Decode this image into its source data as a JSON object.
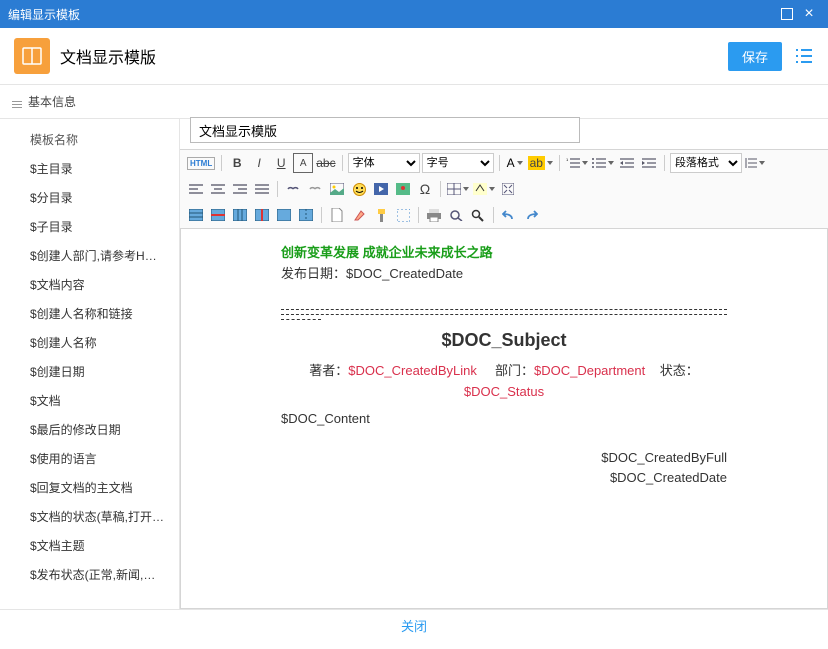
{
  "window": {
    "title": "编辑显示模板"
  },
  "header": {
    "title": "文档显示模版",
    "save": "保存"
  },
  "section": {
    "basic": "基本信息"
  },
  "sidebar": {
    "label": "模板名称",
    "items": [
      "$主目录",
      "$分目录",
      "$子目录",
      "$创建人部门,请参考HRM(...",
      "$文档内容",
      "$创建人名称和链接",
      "$创建人名称",
      "$创建日期",
      "$文档",
      "$最后的修改日期",
      "$使用的语言",
      "$回复文档的主文档",
      "$文档的状态(草稿,打开,正...",
      "$文档主题",
      "$发布状态(正常,新闻,标题..."
    ]
  },
  "form": {
    "template_name": "文档显示模版"
  },
  "toolbar": {
    "font": "字体",
    "size": "字号",
    "para": "段落格式"
  },
  "preview": {
    "green": "创新变革发展 成就企业未来成长之路",
    "pub_label": "发布日期：",
    "pub_var": "$DOC_CreatedDate",
    "subject": "$DOC_Subject",
    "author_label": "著者：",
    "author_var": "$DOC_CreatedByLink",
    "dept_label": "部门：",
    "dept_var": "$DOC_Department",
    "status_label": "状态：",
    "status_var": "$DOC_Status",
    "content_var": "$DOC_Content",
    "footer1": "$DOC_CreatedByFull",
    "footer2": "$DOC_CreatedDate"
  },
  "footer": {
    "close": "关闭"
  }
}
